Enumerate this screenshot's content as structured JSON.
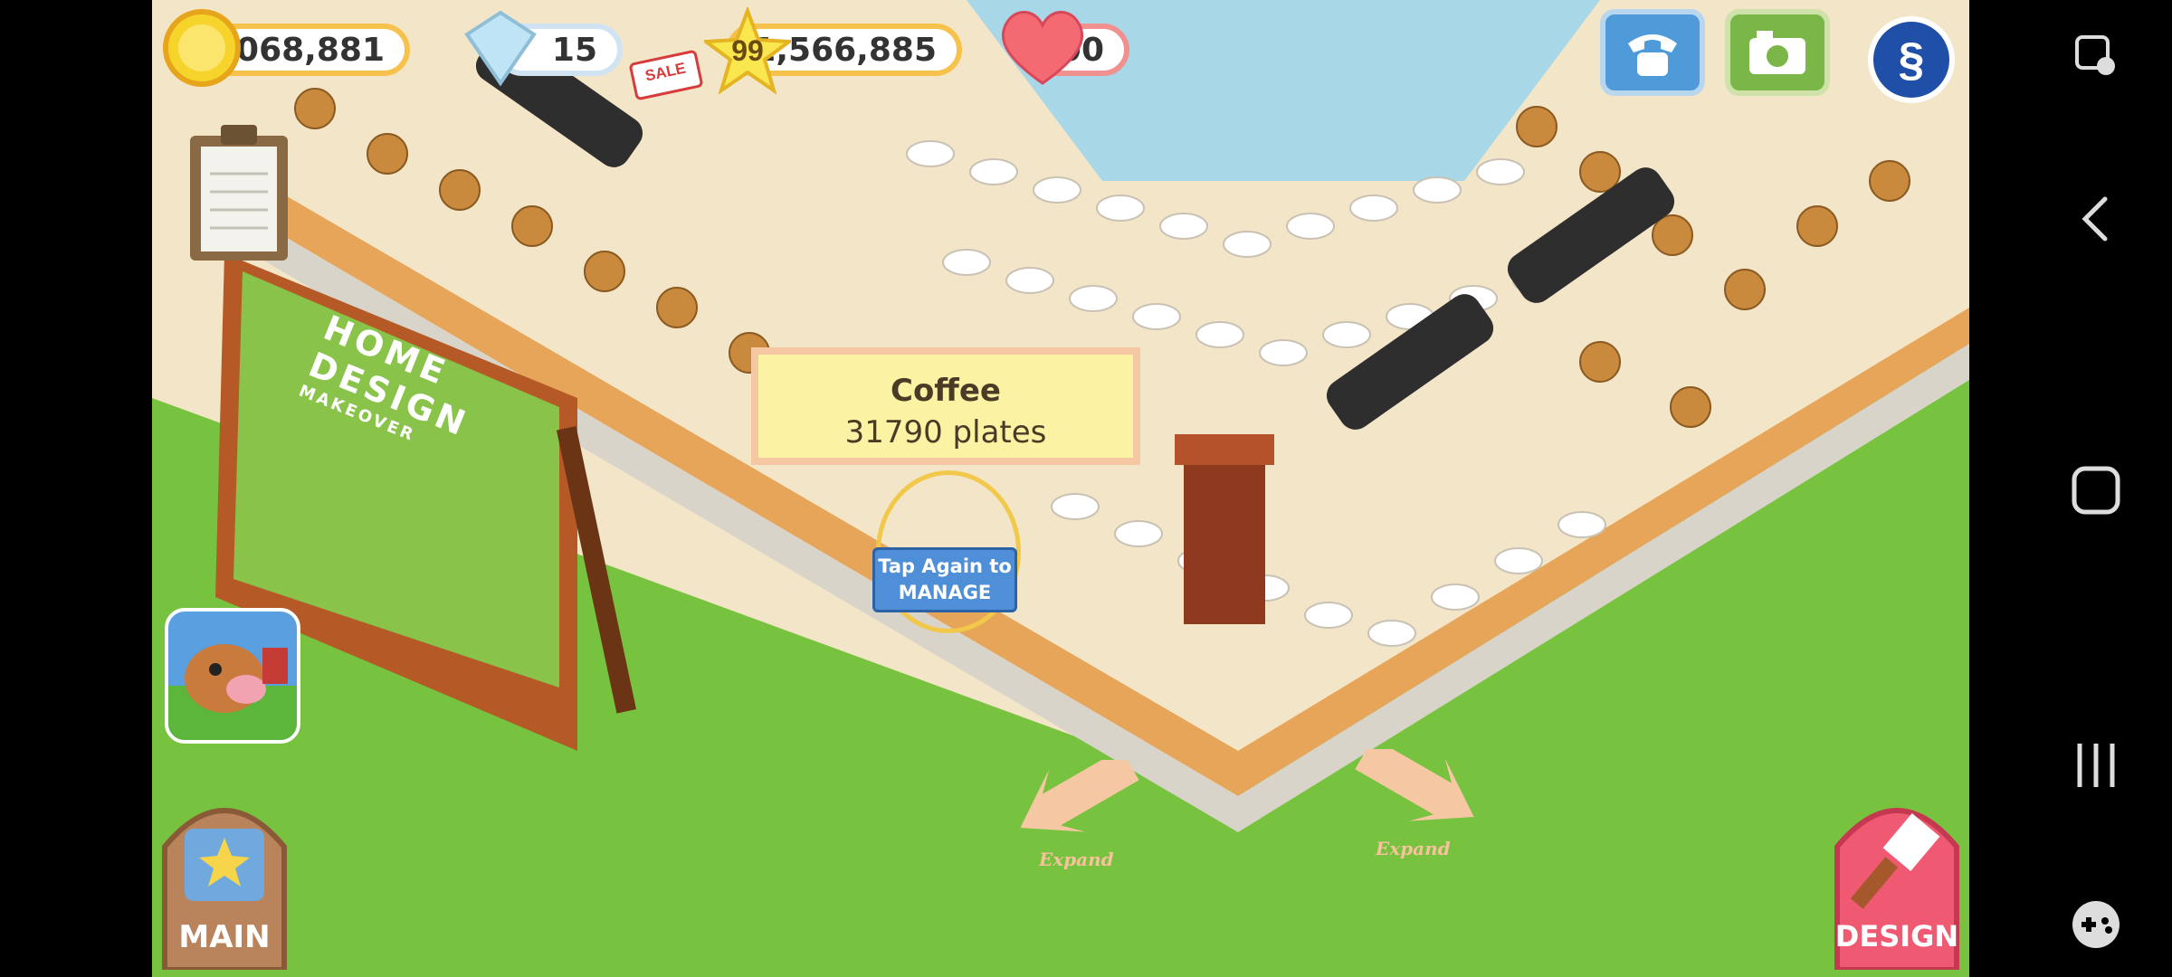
{
  "hud": {
    "coins": "41,068,881",
    "gems": "15",
    "sale_badge": "SALE",
    "level": "99",
    "xp": "1,566,885",
    "hearts": "100"
  },
  "tooltip": {
    "item_name": "Coffee",
    "item_count": "31790 plates"
  },
  "manage_hint": {
    "line1": "Tap Again to",
    "line2": "MANAGE"
  },
  "billboard": {
    "line1": "HOME",
    "line2": "DESIGN",
    "line3": "MAKEOVER"
  },
  "buttons": {
    "main": "MAIN",
    "design": "DESIGN",
    "expand_left": "Expand",
    "expand_right": "Expand"
  },
  "icons": {
    "coin": "coin-icon",
    "gem": "gem-icon",
    "star": "star-icon",
    "heart": "heart-icon",
    "phone": "phone-icon",
    "camera": "camera-icon",
    "social": "social-s-icon",
    "clipboard": "clipboard-icon",
    "nav_back": "back-arrow-icon",
    "nav_home": "home-square-icon",
    "nav_recents": "recents-icon",
    "nav_game": "gamepad-icon",
    "nav_screen": "screenshot-edit-icon"
  },
  "colors": {
    "grass": "#77c23f",
    "coin_border": "#f6c24b",
    "heart_border": "#f0918f",
    "design_btn": "#ef5a72",
    "manage_btn": "#4f8fd8"
  }
}
